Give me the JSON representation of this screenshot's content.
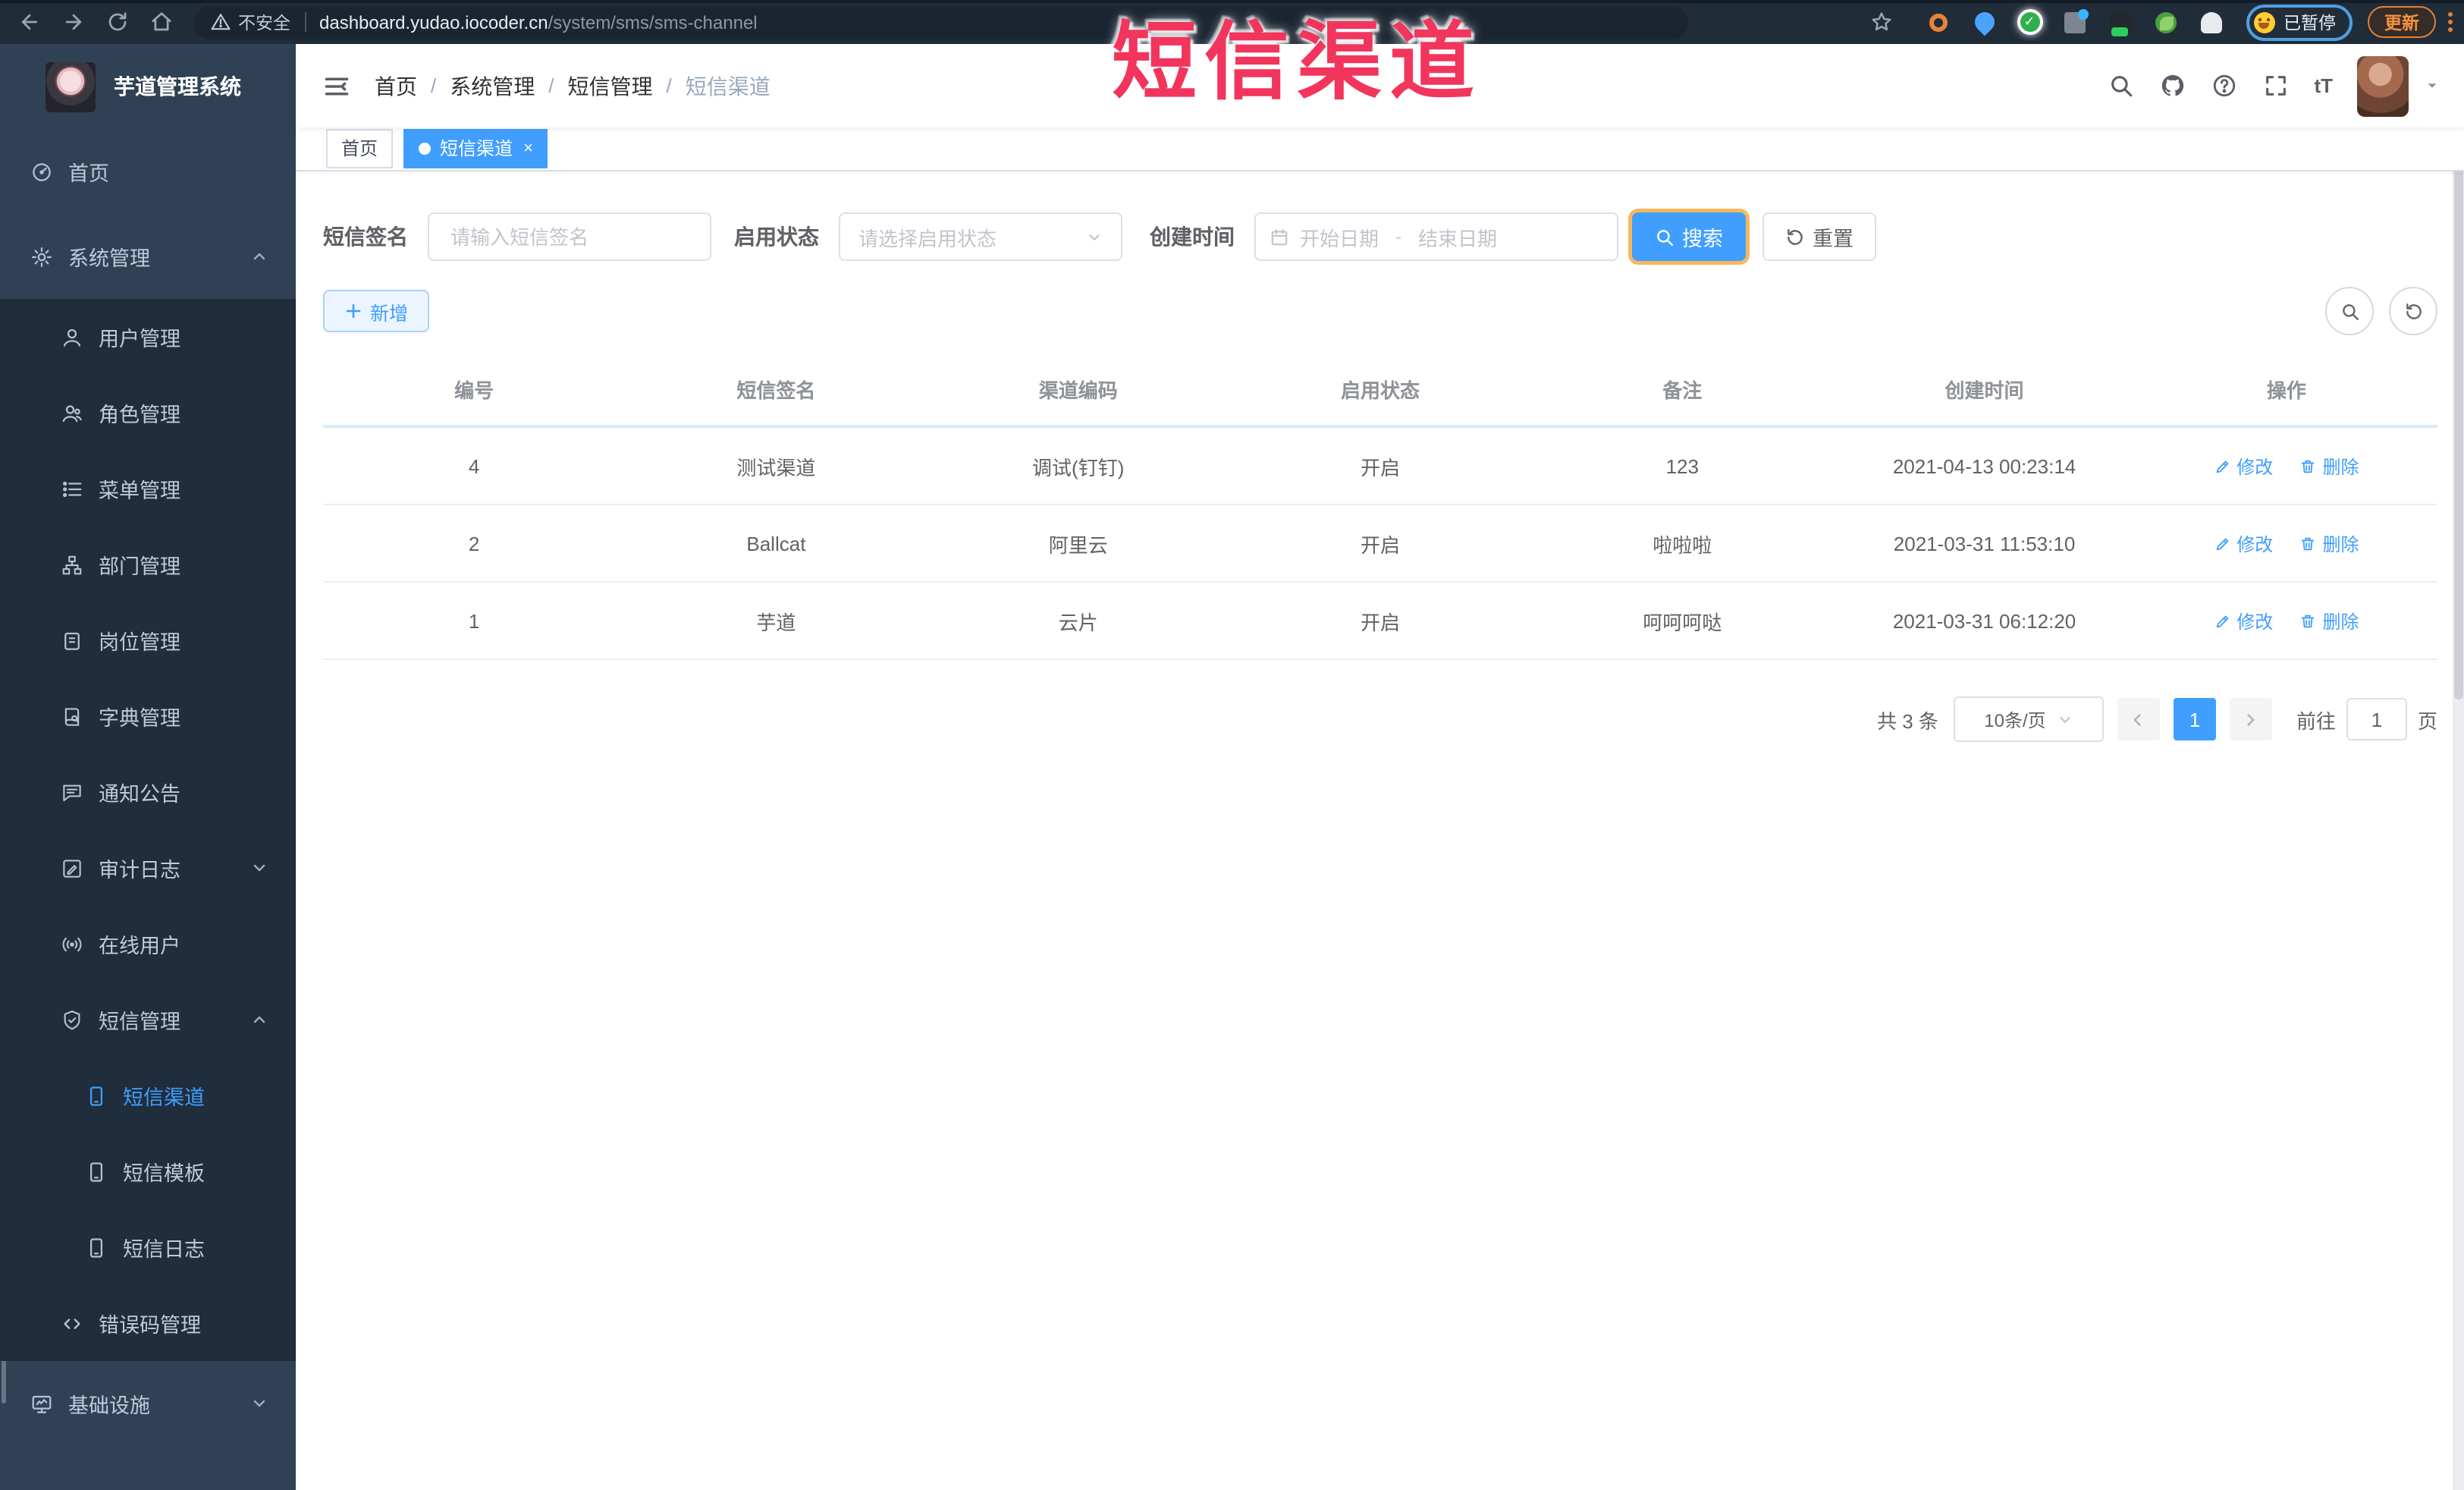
{
  "browser": {
    "security_label": "不安全",
    "url_host": "dashboard.yudao.iocoder.cn",
    "url_path": "/system/sms/sms-channel",
    "paused_badge": "已暂停",
    "update_label": "更新"
  },
  "overlay": {
    "title": "短信渠道"
  },
  "sidebar": {
    "app_title": "芋道管理系统",
    "items": [
      {
        "label": "首页",
        "icon": "dashboard-icon"
      },
      {
        "label": "系统管理",
        "icon": "gear-icon",
        "chevron": "up"
      },
      {
        "label": "用户管理",
        "icon": "user-icon"
      },
      {
        "label": "角色管理",
        "icon": "role-icon"
      },
      {
        "label": "菜单管理",
        "icon": "menu-list-icon"
      },
      {
        "label": "部门管理",
        "icon": "org-tree-icon"
      },
      {
        "label": "岗位管理",
        "icon": "post-icon"
      },
      {
        "label": "字典管理",
        "icon": "dict-icon"
      },
      {
        "label": "通知公告",
        "icon": "notice-icon"
      },
      {
        "label": "审计日志",
        "icon": "log-icon",
        "chevron": "down"
      },
      {
        "label": "在线用户",
        "icon": "online-icon"
      },
      {
        "label": "短信管理",
        "icon": "sms-shield-icon",
        "chevron": "up"
      },
      {
        "label": "短信渠道",
        "icon": "phone-icon",
        "active": true
      },
      {
        "label": "短信模板",
        "icon": "phone-icon"
      },
      {
        "label": "短信日志",
        "icon": "phone-icon"
      },
      {
        "label": "错误码管理",
        "icon": "code-icon"
      },
      {
        "label": "基础设施",
        "icon": "infra-icon",
        "chevron": "down"
      }
    ]
  },
  "header": {
    "breadcrumb": [
      "首页",
      "系统管理",
      "短信管理",
      "短信渠道"
    ],
    "breadcrumb_separator": "/",
    "font_size_icon_text": "tT"
  },
  "tabs": [
    {
      "label": "首页",
      "active": false
    },
    {
      "label": "短信渠道",
      "active": true,
      "close": "×"
    }
  ],
  "filters": {
    "sign_label": "短信签名",
    "sign_placeholder": "请输入短信签名",
    "status_label": "启用状态",
    "status_placeholder": "请选择启用状态",
    "time_label": "创建时间",
    "start_placeholder": "开始日期",
    "range_separator": "-",
    "end_placeholder": "结束日期",
    "search_label": "搜索",
    "reset_label": "重置"
  },
  "toolbar": {
    "add_label": "新增"
  },
  "table": {
    "headers": [
      "编号",
      "短信签名",
      "渠道编码",
      "启用状态",
      "备注",
      "创建时间",
      "操作"
    ],
    "edit_label": "修改",
    "delete_label": "删除",
    "rows": [
      {
        "id": "4",
        "sign": "测试渠道",
        "code": "调试(钉钉)",
        "status": "开启",
        "remark": "123",
        "created": "2021-04-13 00:23:14"
      },
      {
        "id": "2",
        "sign": "Ballcat",
        "code": "阿里云",
        "status": "开启",
        "remark": "啦啦啦",
        "created": "2021-03-31 11:53:10"
      },
      {
        "id": "1",
        "sign": "芋道",
        "code": "云片",
        "status": "开启",
        "remark": "呵呵呵哒",
        "created": "2021-03-31 06:12:20"
      }
    ]
  },
  "pagination": {
    "total_label": "共 3 条",
    "page_size": "10条/页",
    "current_page": "1",
    "goto_label": "前往",
    "goto_value": "1",
    "page_unit": "页"
  },
  "colors": {
    "accent": "#409eff",
    "sidebar_bg": "#304156",
    "submenu_bg": "#1f2d3d",
    "overlay_red": "#f2355c",
    "update_orange": "#e08236",
    "header_underline": "#d8ecfb"
  }
}
